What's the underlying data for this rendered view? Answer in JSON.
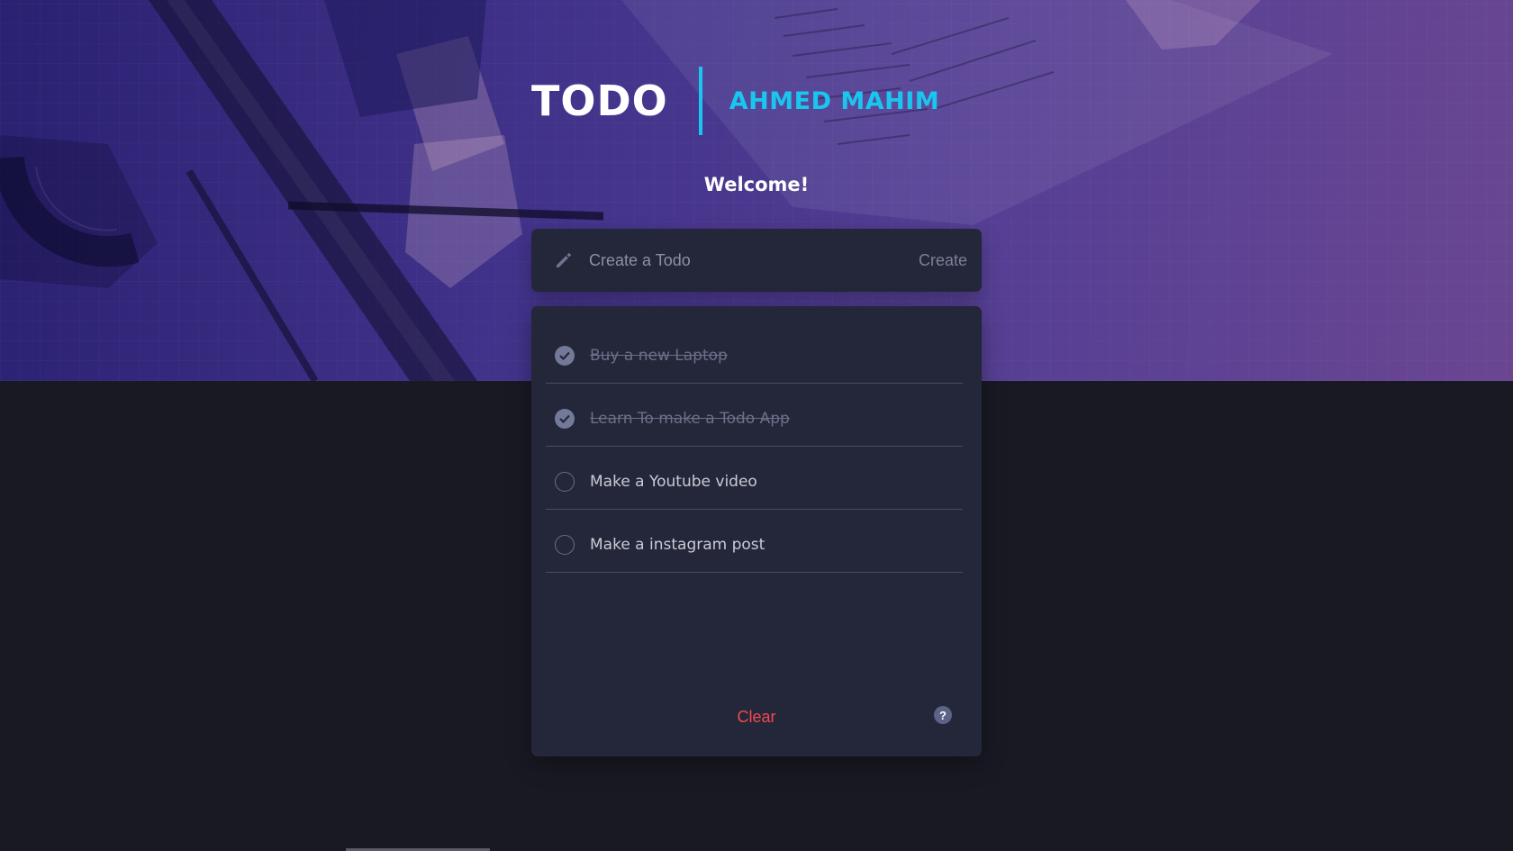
{
  "header": {
    "title": "TODO",
    "author": "AHMED MAHIM",
    "welcome": "Welcome!"
  },
  "create": {
    "placeholder": "Create a Todo",
    "button_label": "Create",
    "icon": "pencil-icon"
  },
  "todos": [
    {
      "text": "Buy a new Laptop",
      "done": true
    },
    {
      "text": "Learn To make a Todo App",
      "done": true
    },
    {
      "text": "Make a Youtube video",
      "done": false
    },
    {
      "text": "Make a instagram post",
      "done": false
    }
  ],
  "footer": {
    "clear_label": "Clear",
    "help_label": "?"
  },
  "colors": {
    "accent": "#19c6ef",
    "clear": "#f04b4b",
    "panel": "#24273a",
    "background": "#181923"
  }
}
